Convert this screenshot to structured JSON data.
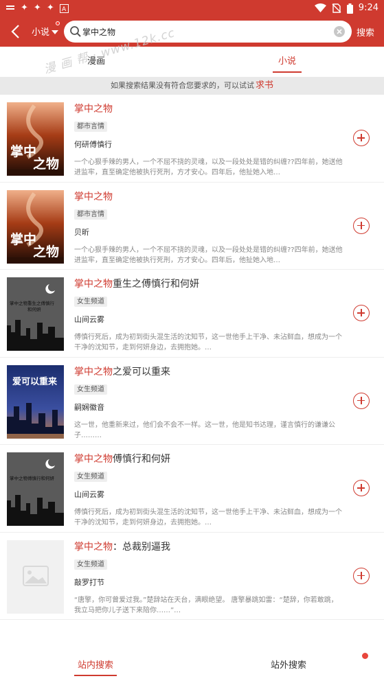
{
  "status_bar": {
    "time": "9:24",
    "icons": [
      "notification-icon",
      "bug-icon",
      "bug-icon",
      "bug-icon",
      "a-icon",
      "wifi-icon",
      "no-sim-icon",
      "battery-icon"
    ]
  },
  "header": {
    "scope_label": "小说",
    "search_value": "掌中之物",
    "search_button": "搜索"
  },
  "watermark": "漫 画 帮 ·  www.12k.cc",
  "tabs": [
    {
      "label": "漫画",
      "active": false
    },
    {
      "label": "小说",
      "active": true
    }
  ],
  "notice": {
    "text": "如果搜索结果没有符合您要求的，可以试试",
    "link": "求书"
  },
  "results": [
    {
      "title_highlight": "掌中之物",
      "title_rest": "",
      "tag": "都市言情",
      "author": "何研傅慎行",
      "desc": "一个心狠手辣的男人，一个不屈不挠的灵魂，以及一段处处是错的纠缠??四年前，她送他进监牢，直至确定他被执行死刑，方才安心。四年后，他扯她入地…",
      "cover_text": "掌中之物"
    },
    {
      "title_highlight": "掌中之物",
      "title_rest": "",
      "tag": "都市言情",
      "author": "贝昕",
      "desc": "一个心狠手辣的男人，一个不屈不挠的灵魂，以及一段处处是错的纠缠??四年前，她送他进监牢，直至确定他被执行死刑，方才安心。四年后，他扯她入地…",
      "cover_text": "掌中之物"
    },
    {
      "title_highlight": "掌中之物",
      "title_rest": "重生之傅慎行和何妍",
      "tag": "女生频道",
      "author": "山间云雾",
      "desc": "傅慎行死后，成为初到街头混生活的沈知节，这一世他手上干净、未沾鲜血，想成为一个干净的沈知节，走到何妍身边，去拥抱她。…",
      "cover_text": "掌中之物重生之傅慎行和何妍"
    },
    {
      "title_highlight": "掌中之物",
      "title_rest": "之爱可以重来",
      "tag": "女生频道",
      "author": "嗣娴徽音",
      "desc": "这一世，他重新来过，他们会不会不一样。这一世，他是知书达理，谨言慎行的谦谦公子………",
      "cover_text": "爱可以重来"
    },
    {
      "title_highlight": "掌中之物",
      "title_rest": "傅慎行和何妍",
      "tag": "女生频道",
      "author": "山间云雾",
      "desc": "傅慎行死后，成为初到街头混生活的沈知节，这一世他手上干净、未沾鲜血，想成为一个干净的沈知节，走到何妍身边，去拥抱她。…",
      "cover_text": "掌中之物傅慎行和何妍"
    },
    {
      "title_highlight": "掌中之物",
      "title_rest": "：总裁别逼我",
      "tag": "女生频道",
      "author": "敲罗打节",
      "desc": "“唐擎，你可曾爱过我。”楚辞站在天台，满眼绝望。      唐擎暴跳如雷：“楚辞，你若敢跳，我立马把你儿子送下来陪你……”…",
      "cover_text": ""
    }
  ],
  "bottom_nav": {
    "in_site": "站内搜索",
    "off_site": "站外搜索"
  },
  "colors": {
    "brand": "#cf3a2f",
    "notice_bg": "#e9e9e9"
  }
}
